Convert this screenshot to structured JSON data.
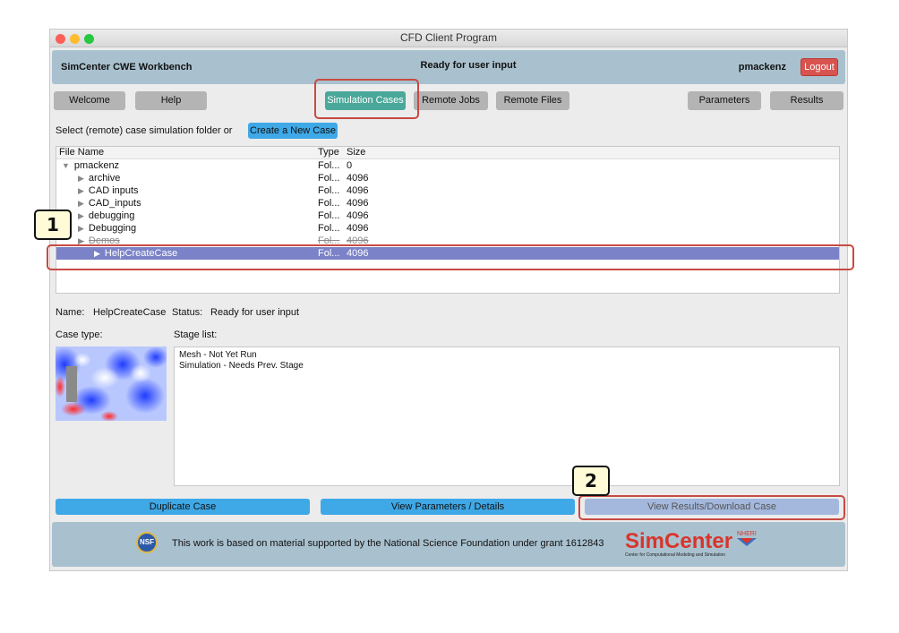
{
  "window": {
    "title": "CFD Client Program"
  },
  "header": {
    "app_name": "SimCenter CWE Workbench",
    "status": "Ready for user input",
    "username": "pmackenz",
    "logout_label": "Logout"
  },
  "tabs": {
    "welcome": "Welcome",
    "help": "Help",
    "simulation_cases": "Simulation Cases",
    "remote_jobs": "Remote Jobs",
    "remote_files": "Remote Files",
    "parameters": "Parameters",
    "results": "Results"
  },
  "select_prompt": "Select (remote) case simulation folder or",
  "create_case_label": "Create a New Case",
  "file_table": {
    "columns": {
      "name": "File Name",
      "type": "Type",
      "size": "Size"
    },
    "rows": [
      {
        "name": "pmackenz",
        "type": "Fol...",
        "size": "0"
      },
      {
        "name": "archive",
        "type": "Fol...",
        "size": "4096"
      },
      {
        "name": "CAD inputs",
        "type": "Fol...",
        "size": "4096"
      },
      {
        "name": "CAD_inputs",
        "type": "Fol...",
        "size": "4096"
      },
      {
        "name": "debugging",
        "type": "Fol...",
        "size": "4096"
      },
      {
        "name": "Debugging",
        "type": "Fol...",
        "size": "4096"
      },
      {
        "name": "Demos",
        "type": "Fol...",
        "size": "4096"
      },
      {
        "name": "HelpCreateCase",
        "type": "Fol...",
        "size": "4096"
      }
    ]
  },
  "case_info": {
    "name_label": "Name:",
    "name_value": "HelpCreateCase",
    "status_label": "Status:",
    "status_value": "Ready for user input",
    "case_type_label": "Case type:",
    "stage_list_label": "Stage list:",
    "stages": [
      "Mesh - Not Yet Run",
      "Simulation - Needs Prev. Stage"
    ]
  },
  "actions": {
    "duplicate": "Duplicate Case",
    "view_params": "View Parameters / Details",
    "view_results": "View Results/Download Case"
  },
  "footer": {
    "nsf_text": "NSF",
    "text": "This work is based on material supported by the National Science Foundation under grant 1612843",
    "logo": "SimCenter",
    "logo_sub": "Center for Computational Modeling and Simulation",
    "nheri": "NHERI"
  },
  "callouts": {
    "one": "1",
    "two": "2"
  },
  "colors": {
    "accent_active_tab": "#4aa89a",
    "create_button": "#3fa8e6",
    "logout": "#d9534f",
    "highlight": "#c84a42",
    "selection": "#7b82c7"
  }
}
